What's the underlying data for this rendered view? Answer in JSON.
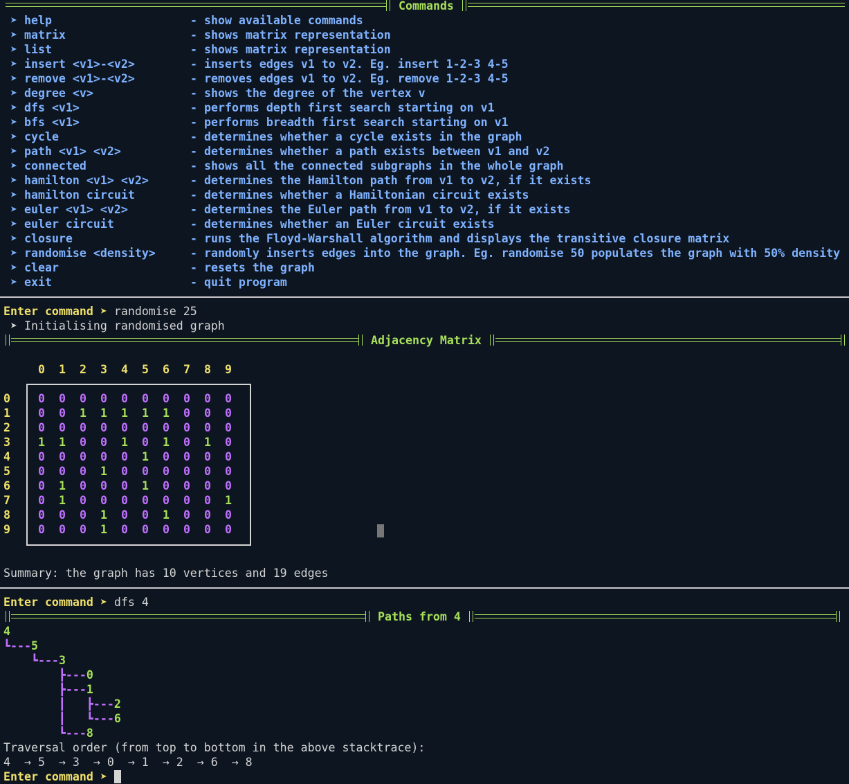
{
  "commands_header": "Commands",
  "commands": [
    {
      "name": "help",
      "desc": "- show available commands"
    },
    {
      "name": "matrix",
      "desc": "- shows matrix representation"
    },
    {
      "name": "list",
      "desc": "- shows matrix representation"
    },
    {
      "name": "insert <v1>-<v2>",
      "desc": "- inserts edges v1 to v2. Eg. insert 1-2-3 4-5"
    },
    {
      "name": "remove <v1>-<v2>",
      "desc": "- removes edges v1 to v2. Eg. remove 1-2-3 4-5"
    },
    {
      "name": "degree <v>",
      "desc": "- shows the degree of the vertex v"
    },
    {
      "name": "dfs <v1>",
      "desc": "- performs depth first search starting on v1"
    },
    {
      "name": "bfs <v1>",
      "desc": "- performs breadth first search starting on v1"
    },
    {
      "name": "cycle",
      "desc": "- determines whether a cycle exists in the graph"
    },
    {
      "name": "path <v1> <v2>",
      "desc": "- determines whether a path exists between v1 and v2"
    },
    {
      "name": "connected",
      "desc": "- shows all the connected subgraphs in the whole graph"
    },
    {
      "name": "hamilton <v1> <v2>",
      "desc": "- determines the Hamilton path from v1 to v2, if it exists"
    },
    {
      "name": "hamilton circuit",
      "desc": "- determines whether a Hamiltonian circuit exists"
    },
    {
      "name": "euler <v1> <v2>",
      "desc": "- determines the Euler path from v1 to v2, if it exists"
    },
    {
      "name": "euler circuit",
      "desc": "- determines whether an Euler circuit exists"
    },
    {
      "name": "closure",
      "desc": "- runs the Floyd-Warshall algorithm and displays the transitive closure matrix"
    },
    {
      "name": "randomise <density>",
      "desc": "- randomly inserts edges into the graph. Eg. randomise 50 populates the graph with 50% density"
    },
    {
      "name": "clear",
      "desc": "- resets the graph"
    },
    {
      "name": "exit",
      "desc": "- quit program"
    }
  ],
  "bullet": "➤",
  "prompt_label": "Enter command ➤",
  "session1": {
    "input": "randomise 25",
    "output": " ➤ Initialising randomised graph",
    "header": "Adjacency Matrix",
    "column_labels": [
      "0",
      "1",
      "2",
      "3",
      "4",
      "5",
      "6",
      "7",
      "8",
      "9"
    ],
    "row_labels": [
      "0",
      "1",
      "2",
      "3",
      "4",
      "5",
      "6",
      "7",
      "8",
      "9"
    ],
    "matrix": [
      [
        0,
        0,
        0,
        0,
        0,
        0,
        0,
        0,
        0,
        0
      ],
      [
        0,
        0,
        1,
        1,
        1,
        1,
        1,
        0,
        0,
        0
      ],
      [
        0,
        0,
        0,
        0,
        0,
        0,
        0,
        0,
        0,
        0
      ],
      [
        1,
        1,
        0,
        0,
        1,
        0,
        1,
        0,
        1,
        0
      ],
      [
        0,
        0,
        0,
        0,
        0,
        1,
        0,
        0,
        0,
        0
      ],
      [
        0,
        0,
        0,
        1,
        0,
        0,
        0,
        0,
        0,
        0
      ],
      [
        0,
        1,
        0,
        0,
        0,
        1,
        0,
        0,
        0,
        0
      ],
      [
        0,
        1,
        0,
        0,
        0,
        0,
        0,
        0,
        0,
        1
      ],
      [
        0,
        0,
        0,
        1,
        0,
        0,
        1,
        0,
        0,
        0
      ],
      [
        0,
        0,
        0,
        1,
        0,
        0,
        0,
        0,
        0,
        0
      ]
    ],
    "summary": "Summary: the graph has 10 vertices and 19 edges"
  },
  "session2": {
    "input": "dfs 4",
    "header": "Paths from 4",
    "tree": [
      {
        "prefix": "",
        "node": "4"
      },
      {
        "prefix": "┗---",
        "node": "5"
      },
      {
        "prefix": "    ┗---",
        "node": "3"
      },
      {
        "prefix": "        ┣---",
        "node": "0"
      },
      {
        "prefix": "        ┣---",
        "node": "1"
      },
      {
        "prefix": "        ┃   ┣---",
        "node": "2"
      },
      {
        "prefix": "        ┃   ┗---",
        "node": "6"
      },
      {
        "prefix": "        ┗---",
        "node": "8"
      }
    ],
    "traversal_label": "Traversal order (from top to bottom in the above stacktrace):",
    "traversal_order": "4  → 5  → 3  → 0  → 1  → 2  → 6  → 8"
  },
  "colors": {
    "background": "#0d1520",
    "commands": "#7fb2ff",
    "header": "#a8e05a",
    "prompt": "#f0e16b",
    "zero": "#c070ff",
    "one": "#a8e05a"
  }
}
